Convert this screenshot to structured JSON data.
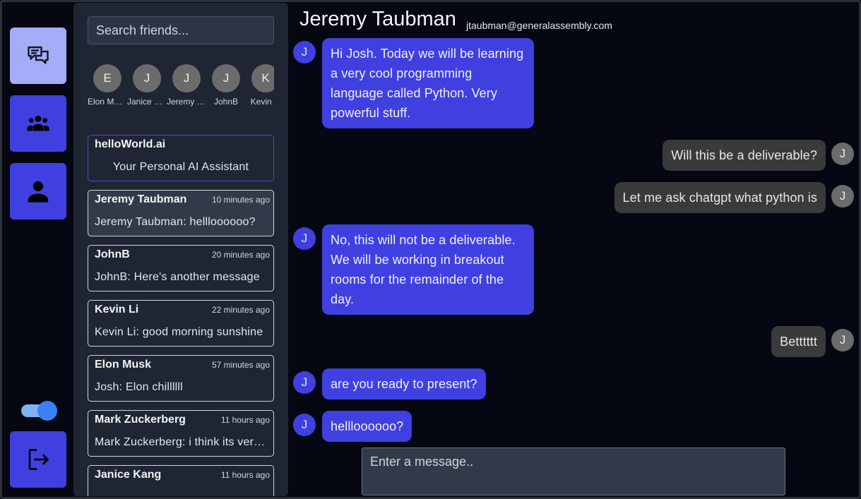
{
  "nav": {
    "items": [
      {
        "name": "chats",
        "icon": "chat-bubbles-icon",
        "active": true
      },
      {
        "name": "friends",
        "icon": "users-group-icon",
        "active": false
      },
      {
        "name": "profile",
        "icon": "user-icon",
        "active": false
      }
    ],
    "logout_icon": "logout-icon",
    "theme_toggle_on": true
  },
  "sidebar": {
    "search_placeholder": "Search friends...",
    "friends": [
      {
        "initial": "E",
        "name": "Elon Musk"
      },
      {
        "initial": "J",
        "name": "Janice Kang"
      },
      {
        "initial": "J",
        "name": "Jeremy Taubman"
      },
      {
        "initial": "J",
        "name": "JohnB"
      },
      {
        "initial": "K",
        "name": "Kevin Li"
      }
    ],
    "ai": {
      "title": "helloWorld.ai",
      "subtitle": "Your Personal AI Assistant"
    },
    "conversations": [
      {
        "name": "Jeremy Taubman",
        "time": "10 minutes ago",
        "preview": "Jeremy Taubman: hellloooooo?",
        "selected": true
      },
      {
        "name": "JohnB",
        "time": "20 minutes ago",
        "preview": "JohnB: Here's another message",
        "selected": false
      },
      {
        "name": "Kevin Li",
        "time": "22 minutes ago",
        "preview": "Kevin Li: good morning sunshine",
        "selected": false
      },
      {
        "name": "Elon Musk",
        "time": "57 minutes ago",
        "preview": "Josh: Elon chillllll",
        "selected": false
      },
      {
        "name": "Mark Zuckerberg",
        "time": "11 hours ago",
        "preview": "Mark Zuckerberg: i think its very cool",
        "selected": false
      },
      {
        "name": "Janice Kang",
        "time": "11 hours ago",
        "preview": "",
        "selected": false
      }
    ]
  },
  "chat": {
    "title": "Jeremy Taubman",
    "email": "jtaubman@generalassembly.com",
    "messages": [
      {
        "side": "in",
        "initial": "J",
        "lines": [
          "Hi Josh. Today we will be learning",
          "a very cool programming",
          "language called Python. Very",
          "powerful stuff."
        ]
      },
      {
        "side": "out",
        "initial": "J",
        "lines": [
          "Will this be a deliverable?"
        ]
      },
      {
        "side": "out",
        "initial": "J",
        "lines": [
          "Let me ask chatgpt what python is"
        ]
      },
      {
        "side": "in",
        "initial": "J",
        "lines": [
          "No, this will not be a deliverable.",
          "We will be working in breakout",
          "rooms for the remainder of the",
          "day."
        ]
      },
      {
        "side": "out",
        "initial": "J",
        "lines": [
          "Betttttt"
        ]
      },
      {
        "side": "in",
        "initial": "J",
        "lines": [
          "are you ready to present?"
        ]
      },
      {
        "side": "in",
        "initial": "J",
        "lines": [
          "hellloooooo?"
        ]
      }
    ],
    "input_placeholder": "Enter a message.."
  },
  "colors": {
    "accent": "#4040e0",
    "accent_light": "#a5adf8",
    "sidebar_bg": "#1f2532",
    "page_bg": "#050812",
    "outgoing_bubble": "#3a3a3a"
  }
}
